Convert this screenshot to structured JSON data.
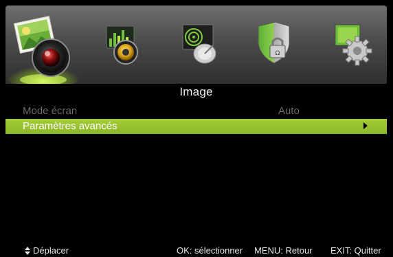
{
  "tabs": [
    {
      "icon": "image-camera-icon",
      "selected": true
    },
    {
      "icon": "sound-speaker-icon",
      "selected": false
    },
    {
      "icon": "channel-satellite-icon",
      "selected": false
    },
    {
      "icon": "lock-shield-icon",
      "selected": false
    },
    {
      "icon": "settings-gear-icon",
      "selected": false
    }
  ],
  "colors": {
    "highlight": "#9bc632",
    "disabled_text": "#6b6b6b"
  },
  "page_title": "Image",
  "menu": {
    "items": [
      {
        "label": "Mode écran",
        "value": "Auto",
        "state": "disabled"
      },
      {
        "label": "Paramètres avancés",
        "value": "",
        "state": "selected"
      }
    ]
  },
  "footer": {
    "move": "Déplacer",
    "ok": "OK: sélectionner",
    "menu": "MENU: Retour",
    "exit": "EXIT: Quitter"
  }
}
